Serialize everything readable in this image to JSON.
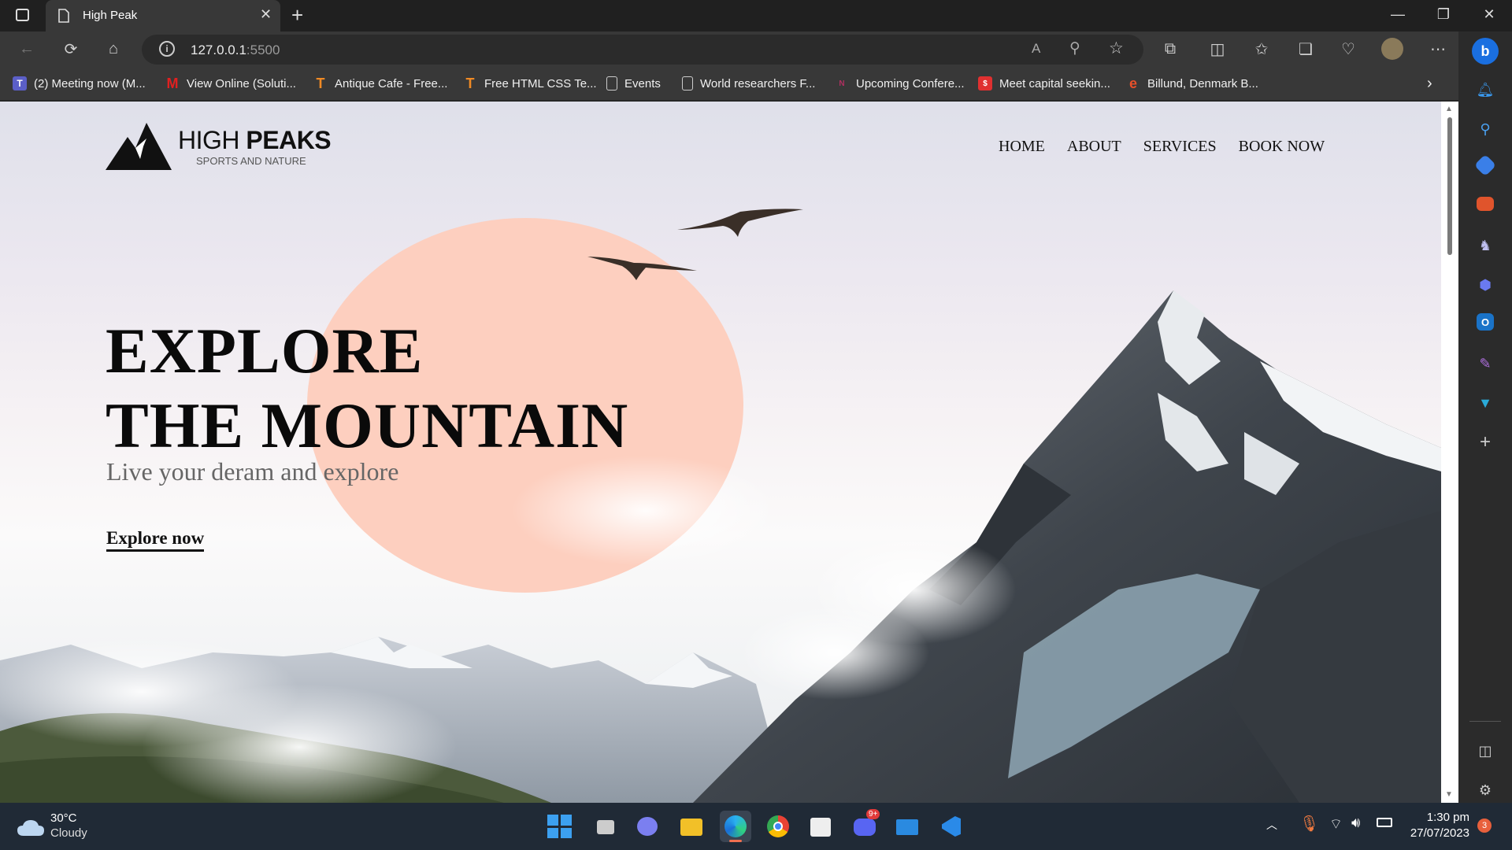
{
  "browser": {
    "tab_title": "High Peak",
    "url_host": "127.0.0.1",
    "url_port": ":5500",
    "bookmarks": [
      {
        "label": "(2) Meeting now (M...",
        "icon": "teams-icon",
        "color": "#5b5fc7"
      },
      {
        "label": "View Online (Soluti...",
        "icon": "m-logo-icon",
        "color": "#e02020"
      },
      {
        "label": "Antique Cafe - Free...",
        "icon": "t-logo-icon",
        "color": "#f08a24"
      },
      {
        "label": "Free HTML CSS Te...",
        "icon": "t-logo-icon",
        "color": "#f08a24"
      },
      {
        "label": "Events",
        "icon": "page-icon",
        "color": "#cccccc"
      },
      {
        "label": "World researchers F...",
        "icon": "page-icon",
        "color": "#cccccc"
      },
      {
        "label": "Upcoming Confere...",
        "icon": "n-logo-icon",
        "color": "#b03060"
      },
      {
        "label": "Meet capital seekin...",
        "icon": "red-badge-icon",
        "color": "#e03030"
      },
      {
        "label": "Billund, Denmark B...",
        "icon": "e-logo-icon",
        "color": "#e8502a"
      }
    ]
  },
  "page": {
    "brand_light": "HIGH ",
    "brand_bold": "PEAKS",
    "tagline": "SPORTS AND NATURE",
    "nav": [
      "HOME",
      "ABOUT",
      "SERVICES",
      "BOOK NOW"
    ],
    "headline_1": "EXPLORE",
    "headline_2": "THE MOUNTAIN",
    "subtitle": "Live your deram and explore",
    "cta": "Explore now",
    "sun_color": "#fdcfbf"
  },
  "taskbar": {
    "weather_temp": "30°C",
    "weather_desc": "Cloudy",
    "time": "1:30 pm",
    "date": "27/07/2023",
    "notification_count": "3",
    "discord_badge": "9+"
  }
}
